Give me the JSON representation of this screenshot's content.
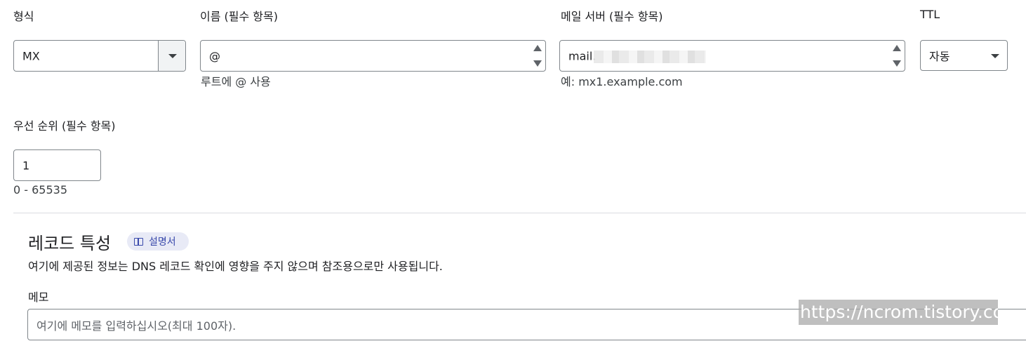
{
  "fields": {
    "type": {
      "label": "형식",
      "value": "MX"
    },
    "name": {
      "label": "이름 (필수 항목)",
      "value": "@",
      "help": "루트에 @ 사용"
    },
    "mail_server": {
      "label": "메일 서버 (필수 항목)",
      "value": "mail.",
      "help": "예: mx1.example.com"
    },
    "ttl": {
      "label": "TTL",
      "value": "자동"
    },
    "priority": {
      "label": "우선 순위 (필수 항목)",
      "value": "1",
      "help": "0 - 65535"
    }
  },
  "record_properties": {
    "title": "레코드 특성",
    "doc_chip": "설명서",
    "description": "여기에 제공된 정보는 DNS 레코드 확인에 영향을 주지 않으며 참조용으로만 사용됩니다.",
    "memo_label": "메모",
    "memo_placeholder": "여기에 메모를 입력하십시오(최대 100자)."
  },
  "watermark": "https://ncrom.tistory.com",
  "colors": {
    "border": "#80868b",
    "chip_bg": "#e8eaf6",
    "chip_text": "#3949ab"
  }
}
